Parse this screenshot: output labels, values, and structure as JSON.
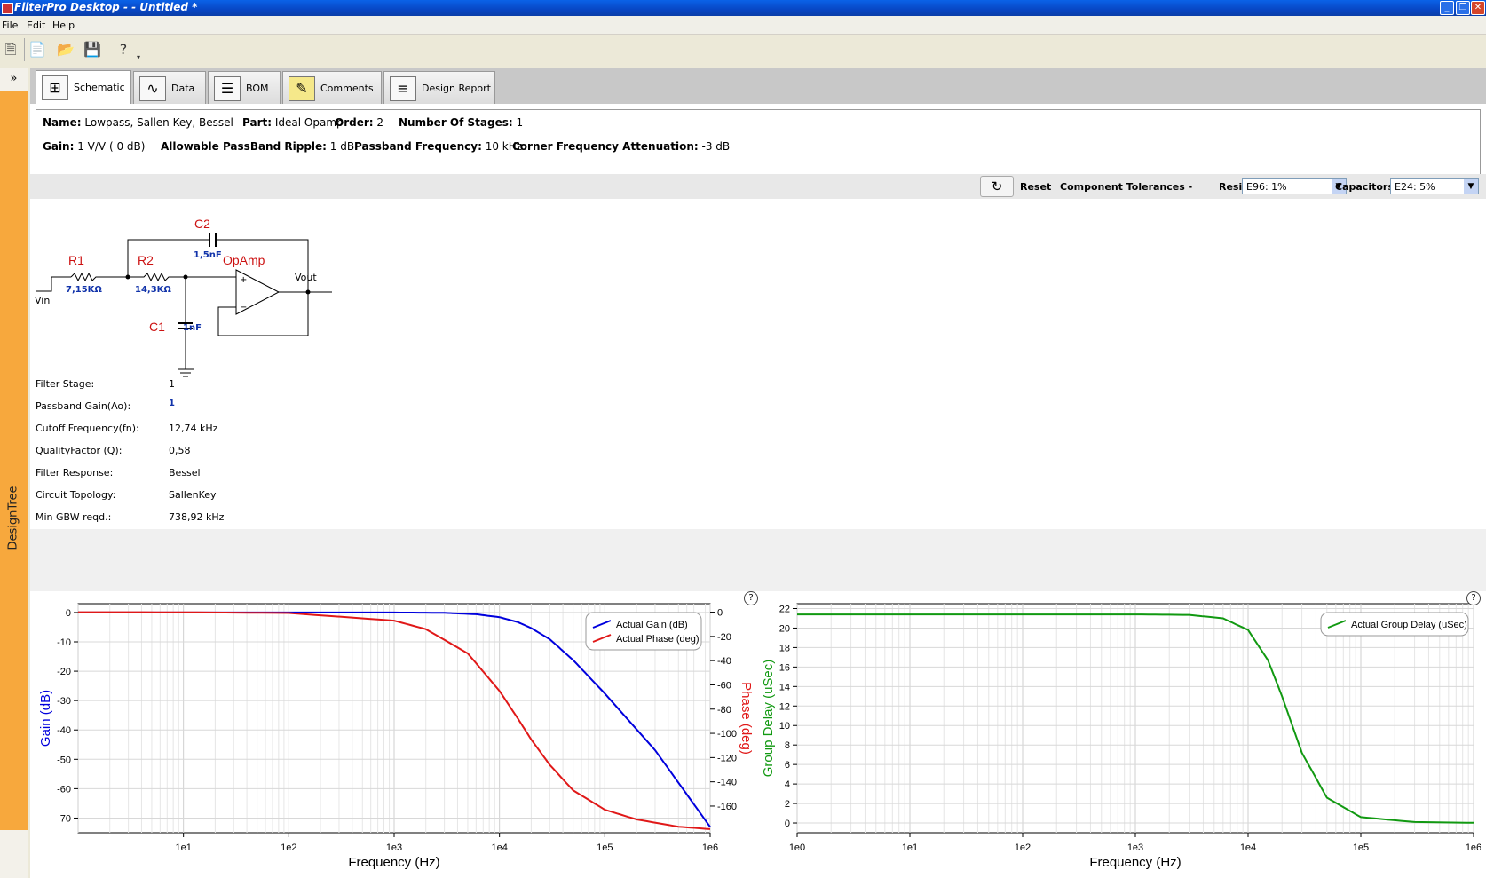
{
  "window": {
    "title": "FilterPro Desktop -  - Untitled *"
  },
  "menu": [
    "File",
    "Edit",
    "Help"
  ],
  "sidebar": {
    "label": "DesignTree",
    "expand": "»"
  },
  "tabs": [
    {
      "label": "Schematic",
      "icon": "schematic-icon"
    },
    {
      "label": "Data",
      "icon": "data-icon"
    },
    {
      "label": "BOM",
      "icon": "bom-icon"
    },
    {
      "label": "Comments",
      "icon": "comments-icon"
    },
    {
      "label": "Design Report",
      "icon": "report-icon"
    }
  ],
  "info": {
    "name_label": "Name:",
    "name": "Lowpass, Sallen Key, Bessel",
    "part_label": "Part:",
    "part": "Ideal Opamp",
    "order_label": "Order:",
    "order": "2",
    "stages_label": "Number Of Stages:",
    "stages": "1",
    "gain_label": "Gain:",
    "gain": "1 V/V ( 0 dB)",
    "ripple_label": "Allowable PassBand Ripple:",
    "ripple": "1 dB",
    "passband_label": "Passband Frequency:",
    "passband": "10 kHz",
    "corner_label": "Corner Frequency Attenuation:",
    "corner": "-3 dB"
  },
  "tolerances": {
    "reset": "Reset",
    "label": "Component Tolerances -",
    "resistors_label": "Resistors",
    "resistors": "E96: 1%",
    "capacitors_label": "Capacitors",
    "capacitors": "E24: 5%"
  },
  "schematic": {
    "r1": "R1",
    "r1_val": "7,15KΩ",
    "r2": "R2",
    "r2_val": "14,3KΩ",
    "c1": "C1",
    "c1_val": "1nF",
    "c2": "C2",
    "c2_val": "1,5nF",
    "opamp": "OpAmp",
    "vin": "Vin",
    "vout": "Vout"
  },
  "properties": [
    {
      "label": "Filter Stage:",
      "value": "1"
    },
    {
      "label": "Passband Gain(Ao):",
      "value": "1"
    },
    {
      "label": "Cutoff Frequency(fn):",
      "value": "12,74 kHz"
    },
    {
      "label": "QualityFactor (Q):",
      "value": "0,58"
    },
    {
      "label": "Filter Response:",
      "value": "Bessel"
    },
    {
      "label": "Circuit Topology:",
      "value": "SallenKey"
    },
    {
      "label": "Min GBW reqd.:",
      "value": "738,92 kHz"
    }
  ],
  "colors": {
    "gain": "#0000dd",
    "phase": "#e01818",
    "delay": "#119911",
    "sidebar": "#f7a83d"
  },
  "chart_data": [
    {
      "type": "line",
      "xlabel": "Frequency (Hz)",
      "ylabel": "Gain (dB)",
      "y2label": "Phase (deg)",
      "xscale": "log",
      "xlim": [
        1,
        1000000
      ],
      "ylim": [
        -75,
        3
      ],
      "y2lim": [
        -182,
        7
      ],
      "xticks": [
        "1e1",
        "1e2",
        "1e3",
        "1e4",
        "1e5",
        "1e6"
      ],
      "yticks": [
        0,
        -10,
        -20,
        -30,
        -40,
        -50,
        -60,
        -70
      ],
      "y2ticks": [
        0,
        -20,
        -40,
        -60,
        -80,
        -100,
        -120,
        -140,
        -160
      ],
      "grid": true,
      "legend": "top-right",
      "series": [
        {
          "name": "Actual Gain (dB)",
          "axis": "left",
          "x": [
            1,
            10,
            100,
            1000,
            3000,
            6000,
            10000,
            15000,
            20000,
            30000,
            50000,
            100000,
            300000,
            1000000
          ],
          "y": [
            0,
            0,
            0,
            0,
            -0.1,
            -0.6,
            -1.6,
            -3.3,
            -5.3,
            -9.1,
            -16.2,
            -27.6,
            -46.9,
            -73
          ]
        },
        {
          "name": "Actual Phase (deg)",
          "axis": "right",
          "x": [
            1,
            10,
            100,
            1000,
            2000,
            5000,
            10000,
            15000,
            20000,
            30000,
            50000,
            100000,
            200000,
            500000,
            1000000
          ],
          "y": [
            0,
            -0.1,
            -0.7,
            -7,
            -14,
            -34,
            -65,
            -88,
            -105,
            -126,
            -147,
            -163,
            -171,
            -177,
            -179
          ]
        }
      ]
    },
    {
      "type": "line",
      "xlabel": "Frequency (Hz)",
      "ylabel": "Group Delay (uSec)",
      "xscale": "log",
      "xlim": [
        1,
        1000000
      ],
      "ylim": [
        -1,
        22.5
      ],
      "xticks": [
        "1e0",
        "1e1",
        "1e2",
        "1e3",
        "1e4",
        "1e5",
        "1e6"
      ],
      "yticks": [
        0,
        2,
        4,
        6,
        8,
        10,
        12,
        14,
        16,
        18,
        20,
        22
      ],
      "grid": true,
      "legend": "top-right",
      "series": [
        {
          "name": "Actual Group Delay (uSec)",
          "x": [
            1,
            10,
            100,
            1000,
            3000,
            6000,
            10000,
            15000,
            20000,
            30000,
            50000,
            100000,
            300000,
            1000000
          ],
          "y": [
            21.4,
            21.4,
            21.4,
            21.4,
            21.35,
            21,
            19.8,
            16.7,
            13,
            7.2,
            2.6,
            0.6,
            0.1,
            0.02
          ]
        }
      ]
    }
  ]
}
